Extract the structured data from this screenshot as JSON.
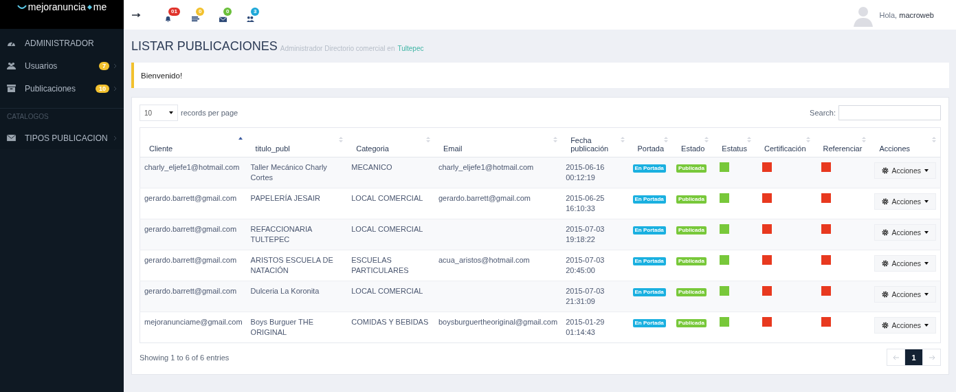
{
  "logo": {
    "left": "mejoranuncia",
    "right": "me"
  },
  "topbar": {
    "notifications": [
      {
        "kind": "bell",
        "count": "01",
        "color": "#e0332b"
      },
      {
        "kind": "tasks",
        "count": "0",
        "color": "#f2c12e"
      },
      {
        "kind": "mail",
        "count": "0",
        "color": "#6abf3a"
      },
      {
        "kind": "users",
        "count": "3",
        "color": "#1fa8d8"
      }
    ],
    "greeting": "Hola,",
    "user": "macroweb"
  },
  "sidebar": {
    "items": [
      {
        "kind": "dashboard",
        "label": "ADMINISTRADOR"
      },
      {
        "kind": "users",
        "label": "Usuarios",
        "badge": "7",
        "chevron": true
      },
      {
        "kind": "archive",
        "label": "Publicaciones",
        "badge": "10",
        "chevron": true
      },
      {
        "kind": "section",
        "label": "CATALOGOS"
      },
      {
        "kind": "mail",
        "label": "TIPOS PUBLICACION",
        "chevron": true
      }
    ]
  },
  "page": {
    "title": "LISTAR PUBLICACIONES",
    "subtitle": "Administrador Directorio comercial en",
    "subtitle_link": "Tultepec"
  },
  "alert": "Bienvenido!",
  "table": {
    "page_size": "10",
    "page_size_label": "records per page",
    "search_label": "Search:",
    "columns": [
      {
        "label": "Cliente",
        "sorted": true
      },
      {
        "label": "titulo_publ",
        "sorted": false
      },
      {
        "label": "Categoria",
        "sorted": false
      },
      {
        "label": "Email",
        "sorted": false
      },
      {
        "label": "Fecha publicación",
        "sorted": false
      },
      {
        "label": "Portada",
        "sorted": false
      },
      {
        "label": "Estado",
        "sorted": false
      },
      {
        "label": "Estatus",
        "sorted": false
      },
      {
        "label": "Certificación",
        "sorted": false
      },
      {
        "label": "Referenciar",
        "sorted": false
      },
      {
        "label": "Acciones",
        "sorted": false
      }
    ],
    "rows": [
      {
        "cliente": "charly_eljefe1@hotmail.com",
        "titulo": "Taller Mecánico Charly Cortes",
        "categoria": "MECANICO",
        "email": "charly_eljefe1@hotmail.com",
        "fecha": "2015-06-16 00:12:19",
        "portada": "En Portada",
        "estado": "Publicada",
        "estatus": true,
        "certificacion": false,
        "referenciar": false,
        "acciones": "Acciones"
      },
      {
        "cliente": "gerardo.barrett@gmail.com",
        "titulo": "PAPELERÍA JESAIR",
        "categoria": "LOCAL COMERCIAL",
        "email": "gerardo.barrett@gmail.com",
        "fecha": "2015-06-25 16:10:33",
        "portada": "En Portada",
        "estado": "Publicada",
        "estatus": true,
        "certificacion": false,
        "referenciar": false,
        "acciones": "Acciones"
      },
      {
        "cliente": "gerardo.barrett@gmail.com",
        "titulo": "REFACCIONARIA TULTEPEC",
        "categoria": "LOCAL COMERCIAL",
        "fecha": "2015-07-03 19:18:22",
        "portada": "En Portada",
        "estado": "Publicada",
        "estatus": true,
        "certificacion": false,
        "referenciar": false,
        "acciones": "Acciones"
      },
      {
        "cliente": "gerardo.barrett@gmail.com",
        "titulo": "ARISTOS ESCUELA DE NATACIÓN",
        "categoria": "ESCUELAS PARTICULARES",
        "email": "acua_aristos@hotmail.com",
        "fecha": "2015-07-03 20:45:00",
        "portada": "En Portada",
        "estado": "Publicada",
        "estatus": true,
        "certificacion": false,
        "referenciar": false,
        "acciones": "Acciones"
      },
      {
        "cliente": "gerardo.barrett@gmail.com",
        "titulo": "Dulceria La Koronita",
        "categoria": "LOCAL COMERCIAL",
        "fecha": "2015-07-03 21:31:09",
        "portada": "En Portada",
        "estado": "Publicada",
        "estatus": true,
        "certificacion": false,
        "referenciar": false,
        "acciones": "Acciones"
      },
      {
        "cliente": "mejoranunciame@gmail.com",
        "titulo": "Boys Burguer THE ORIGINAL",
        "categoria": "COMIDAS Y BEBIDAS",
        "email": "boysburguertheoriginal@gmail.com",
        "fecha": "2015-01-29 01:14:43",
        "portada": "En Portada",
        "estado": "Publicada",
        "estatus": true,
        "certificacion": false,
        "referenciar": false,
        "acciones": "Acciones"
      }
    ],
    "info": "Showing 1 to 6 of 6 entries",
    "pages": [
      {
        "label": "1",
        "selected": true
      }
    ]
  }
}
